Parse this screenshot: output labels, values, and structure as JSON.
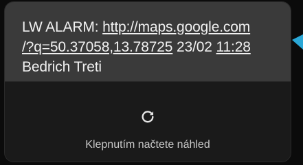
{
  "message": {
    "text_prefix": "LW ALARM: ",
    "link_line1": "http://maps.google.com",
    "link_line2": "/?q=50.37058,13.78725",
    "date": "23/02",
    "time": "11:28",
    "name": "Bedrich Treti"
  },
  "preview": {
    "icon": "refresh-icon",
    "label": "Klepnutím načtete náhled"
  },
  "colors": {
    "message_background": "#3a3a3a",
    "preview_background": "#1a1a1a",
    "page_background": "#0b0b0b",
    "accent": "#2aa7d6"
  }
}
